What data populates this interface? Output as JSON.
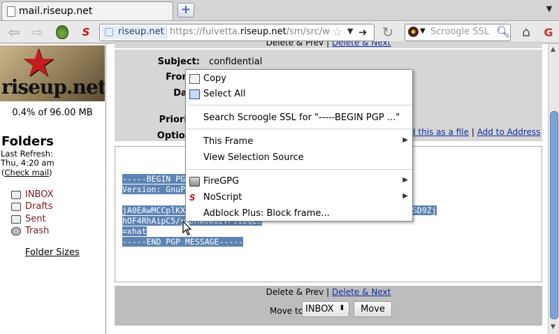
{
  "tab": {
    "title": "mail.riseup.net"
  },
  "navbar": {
    "site_identity": "riseup.net",
    "url_prefix": "https://fulvetta.",
    "url_domain": "riseup.net",
    "url_path": "/sm/src/we",
    "search_placeholder": "Scroogle SSL",
    "noscript_badge": "S"
  },
  "sidebar": {
    "logo_text": "riseup.net",
    "quota": "0.4% of 96.00 MB",
    "folders_title": "Folders",
    "last_refresh_label": "Last Refresh:",
    "last_refresh_time": "Thu, 4:20 am",
    "check_mail_open": "(",
    "check_mail": "Check mail",
    "check_mail_close": ")",
    "folders": [
      {
        "label": "INBOX"
      },
      {
        "label": "Drafts"
      },
      {
        "label": "Sent"
      },
      {
        "label": "Trash"
      }
    ],
    "folder_sizes": "Folder Sizes"
  },
  "message": {
    "top_nav_prev": "Delete & Prev",
    "top_nav_sep": " | ",
    "top_nav_next": "Delete & Next",
    "labels": {
      "subject": "Subject:",
      "from": "From",
      "date": "Dat",
      "to": "T",
      "priority": "Priorit",
      "options": "Option"
    },
    "subject_value": "confidential",
    "links": {
      "download": "d this as a file",
      "sep": " | ",
      "add_address": "Add to Address"
    },
    "pgp_lines": [
      "-----BEGIN PG",
      "Version: GnuP",
      "",
      "jA0EAwMCCplKX",
      "hOF4RhAipC5/y",
      "=xhat",
      "-----END PGP MESSAGE-----"
    ],
    "pgp_tail_1": "SD9Zj",
    "pgp_tail_2": "DHwowuzvP9iBQEc",
    "bottom_nav_prev": "Delete & Prev",
    "bottom_nav_sep": " | ",
    "bottom_nav_next": "Delete & Next",
    "move_to_label": "Move to:",
    "move_to_value": "INBOX",
    "move_button": "Move"
  },
  "context_menu": {
    "items": [
      {
        "label": "Copy",
        "icon": "copy-icon"
      },
      {
        "label": "Select All",
        "icon": "select-all-icon"
      },
      {
        "label": "Search Scroogle SSL for \"-----BEGIN PGP ...\""
      },
      {
        "label": "This Frame",
        "submenu": true
      },
      {
        "label": "View Selection Source"
      },
      {
        "label": "FireGPG",
        "icon": "firegpg-icon",
        "submenu": true
      },
      {
        "label": "NoScript",
        "icon": "noscript-icon",
        "submenu": true
      },
      {
        "label": "Adblock Plus: Block frame..."
      }
    ]
  },
  "colors": {
    "selection": "#5c83b4",
    "header_bg": "#d6d6d6",
    "link": "#1030a0",
    "folder_text": "#7a1a1a"
  }
}
